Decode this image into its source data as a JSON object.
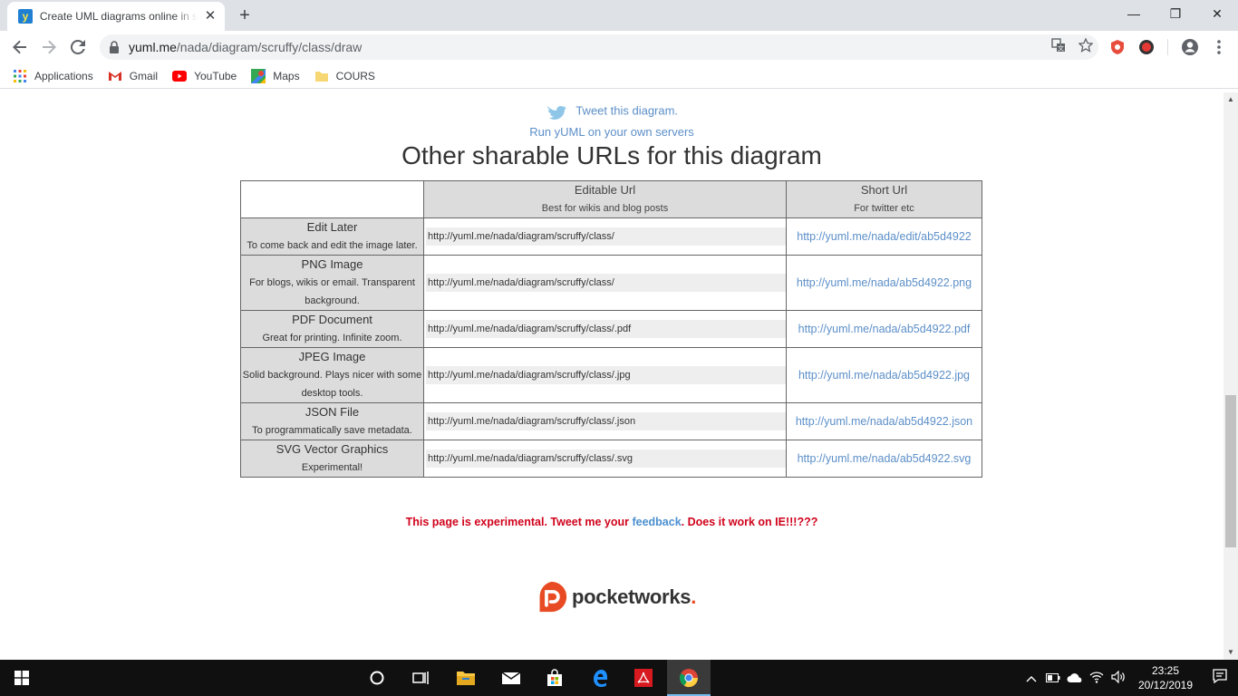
{
  "browser": {
    "tab_title": "Create UML diagrams online in seconds",
    "favicon_letter": "y",
    "close_glyph": "✕",
    "new_tab_glyph": "+",
    "url_host": "yuml.me",
    "url_path": "/nada/diagram/scruffy/class/draw",
    "window_controls": {
      "minimize": "—",
      "maximize": "❐",
      "close": "✕"
    }
  },
  "bookmarks": [
    {
      "label": "Applications",
      "icon": "apps-grid-icon"
    },
    {
      "label": "Gmail",
      "icon": "gmail-icon"
    },
    {
      "label": "YouTube",
      "icon": "youtube-icon"
    },
    {
      "label": "Maps",
      "icon": "maps-icon"
    },
    {
      "label": "COURS",
      "icon": "folder-icon"
    }
  ],
  "page": {
    "tweet_link": "Tweet this diagram.",
    "run_link": "Run yUML on your own servers",
    "heading": "Other sharable URLs for this diagram",
    "table": {
      "headers": [
        {
          "title": "Editable Url",
          "subtitle": "Best for wikis and blog posts"
        },
        {
          "title": "Short Url",
          "subtitle": "For twitter etc"
        }
      ],
      "rows": [
        {
          "title": "Edit Later",
          "desc": "To come back and edit the image later.",
          "editable": "http://yuml.me/nada/diagram/scruffy/class/",
          "short": "http://yuml.me/nada/edit/ab5d4922"
        },
        {
          "title": "PNG Image",
          "desc": "For blogs, wikis or email. Transparent background.",
          "editable": "http://yuml.me/nada/diagram/scruffy/class/",
          "short": "http://yuml.me/nada/ab5d4922.png"
        },
        {
          "title": "PDF Document",
          "desc": "Great for printing. Infinite zoom.",
          "editable": "http://yuml.me/nada/diagram/scruffy/class/.pdf",
          "short": "http://yuml.me/nada/ab5d4922.pdf"
        },
        {
          "title": "JPEG Image",
          "desc": "Solid background. Plays nicer with some desktop tools.",
          "editable": "http://yuml.me/nada/diagram/scruffy/class/.jpg",
          "short": "http://yuml.me/nada/ab5d4922.jpg"
        },
        {
          "title": "JSON File",
          "desc": "To programmatically save metadata.",
          "editable": "http://yuml.me/nada/diagram/scruffy/class/.json",
          "short": "http://yuml.me/nada/ab5d4922.json"
        },
        {
          "title": "SVG Vector Graphics",
          "desc": "Experimental!",
          "editable": "http://yuml.me/nada/diagram/scruffy/class/.svg",
          "short": "http://yuml.me/nada/ab5d4922.svg"
        }
      ]
    },
    "experimental_before": "This page is experimental. Tweet me your ",
    "experimental_link": "feedback",
    "experimental_after": ". Does it work on IE!!!???",
    "footer_brand": "pocketworks",
    "footer_brand_dot": "."
  },
  "taskbar": {
    "time": "23:25",
    "date": "20/12/2019",
    "colors": {
      "accent": "#76b9ed",
      "background": "#101010"
    }
  },
  "colors": {
    "link": "#5c8fc8",
    "warning": "#d0021b",
    "brand": "#e84b24",
    "cell_header": "#dcdcdc"
  }
}
